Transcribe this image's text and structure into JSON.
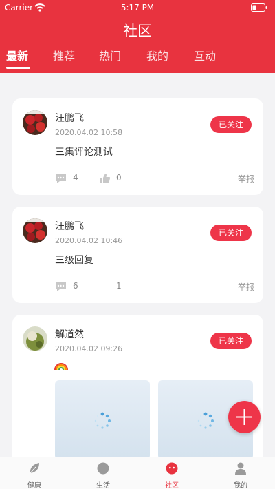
{
  "status_bar": {
    "carrier": "Carrier",
    "time": "5:17 PM",
    "wifi_icon": "wifi-icon",
    "battery_icon": "battery-icon"
  },
  "header": {
    "title": "社区",
    "background": "#e8333f"
  },
  "tabs": [
    {
      "label": "最新",
      "active": true
    },
    {
      "label": "推荐",
      "active": false
    },
    {
      "label": "热门",
      "active": false
    },
    {
      "label": "我的",
      "active": false
    },
    {
      "label": "互动",
      "active": false
    }
  ],
  "posts": [
    {
      "author": "汪鹏飞",
      "time": "2020.04.02 10:58",
      "follow_label": "已关注",
      "content": "三集评论测试",
      "comments": "4",
      "likes": "0",
      "report_label": "举报"
    },
    {
      "author": "汪鹏飞",
      "time": "2020.04.02 10:46",
      "follow_label": "已关注",
      "content": "三级回复",
      "comments": "6",
      "likes": "1",
      "report_label": "举报"
    },
    {
      "author": "解道然",
      "time": "2020.04.02 09:26",
      "follow_label": "已关注",
      "content_icon": "rainbow-emoji",
      "media_count": 2
    }
  ],
  "fab_icon": "plus-icon",
  "bottom_nav": [
    {
      "label": "健康",
      "icon": "leaf-icon",
      "active": false
    },
    {
      "label": "生活",
      "icon": "circle-icon",
      "active": false
    },
    {
      "label": "社区",
      "icon": "community-icon",
      "active": true
    },
    {
      "label": "我的",
      "icon": "person-icon",
      "active": false
    }
  ],
  "colors": {
    "accent": "#e8333f",
    "follow_button": "#ee3549",
    "background": "#f3f3f5"
  }
}
